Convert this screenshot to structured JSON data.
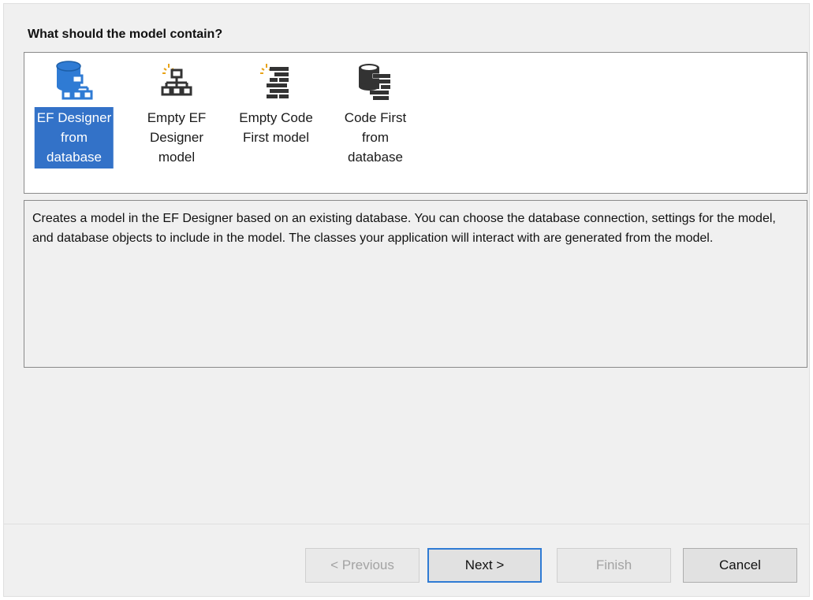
{
  "prompt": "What should the model contain?",
  "templates": [
    {
      "label": "EF Designer\nfrom\ndatabase",
      "icon": "database-diagram-icon",
      "selected": true
    },
    {
      "label": "Empty EF\nDesigner\nmodel",
      "icon": "new-diagram-icon",
      "selected": false
    },
    {
      "label": "Empty Code\nFirst model",
      "icon": "new-code-icon",
      "selected": false
    },
    {
      "label": "Code First\nfrom\ndatabase",
      "icon": "database-code-icon",
      "selected": false
    }
  ],
  "description": "Creates a model in the EF Designer based on an existing database. You can choose the database connection, settings for the model, and database objects to include in the model. The classes your application will interact with are generated from the model.",
  "buttons": {
    "previous": "< Previous",
    "next": "Next >",
    "finish": "Finish",
    "cancel": "Cancel"
  },
  "colors": {
    "selection": "#3372c8",
    "default_button_border": "#2f7bd4",
    "icon_blue": "#2f7bd4",
    "icon_dark": "#333333",
    "sparkle": "#e8a317"
  }
}
